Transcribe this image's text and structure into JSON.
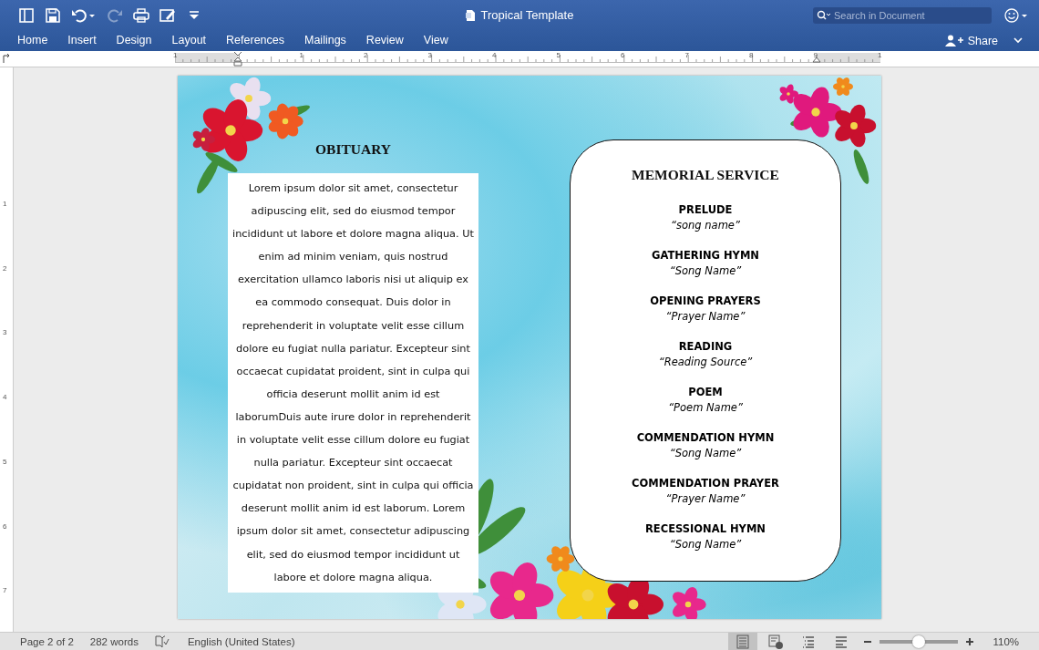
{
  "window": {
    "title": "Tropical Template"
  },
  "quick_access": [
    {
      "kind": "sidebar",
      "disabled": false
    },
    {
      "kind": "save",
      "disabled": false
    },
    {
      "kind": "undo",
      "disabled": false
    },
    {
      "kind": "redo",
      "disabled": true
    },
    {
      "kind": "print",
      "disabled": false
    },
    {
      "kind": "edit",
      "disabled": false
    },
    {
      "kind": "more",
      "disabled": false
    }
  ],
  "search": {
    "placeholder": "Search in Document"
  },
  "ribbon_tabs": [
    {
      "label": "Home",
      "selected": false
    },
    {
      "label": "Insert",
      "selected": false
    },
    {
      "label": "Design",
      "selected": false
    },
    {
      "label": "Layout",
      "selected": false
    },
    {
      "label": "References",
      "selected": false
    },
    {
      "label": "Mailings",
      "selected": false
    },
    {
      "label": "Review",
      "selected": false
    },
    {
      "label": "View",
      "selected": false
    }
  ],
  "share_button": {
    "label": "Share"
  },
  "ruler": {
    "labels": [
      "1",
      "1",
      "2",
      "3",
      "4",
      "5",
      "6",
      "7",
      "8",
      "9",
      "1"
    ]
  },
  "vertical_ruler": {
    "labels": [
      "1",
      "2",
      "3",
      "4",
      "5",
      "6",
      "7"
    ]
  },
  "document": {
    "obituary": {
      "heading": "OBITUARY",
      "body": "Lorem ipsum dolor sit amet, consectetur adipuscing elit, sed do eiusmod tempor incididunt ut labore et dolore magna aliqua. Ut enim ad minim veniam, quis nostrud exercitation ullamco laboris nisi ut aliquip ex ea commodo consequat. Duis dolor in reprehenderit in voluptate velit esse cillum dolore eu fugiat nulla pariatur. Excepteur sint occaecat cupidatat proident, sint in culpa qui officia deserunt mollit anim id est laborumDuis aute irure dolor in reprehenderit in voluptate velit esse cillum dolore eu fugiat nulla pariatur. Excepteur sint occaecat cupidatat non proident, sint in culpa qui officia deserunt mollit anim id est laborum. Lorem ipsum dolor sit amet, consectetur adipuscing elit, sed do eiusmod tempor incididunt ut labore et dolore magna aliqua."
    },
    "service": {
      "heading": "MEMORIAL SERVICE",
      "items": [
        {
          "title": "PRELUDE",
          "name": "“song name”"
        },
        {
          "title": "GATHERING HYMN",
          "name": "“Song Name”"
        },
        {
          "title": "OPENING PRAYERS",
          "name": "“Prayer Name”"
        },
        {
          "title": "READING",
          "name": "“Reading Source”"
        },
        {
          "title": "POEM",
          "name": "“Poem Name”"
        },
        {
          "title": "COMMENDATION HYMN",
          "name": "“Song Name”"
        },
        {
          "title": "COMMENDATION PRAYER",
          "name": "“Prayer Name”"
        },
        {
          "title": "RECESSIONAL HYMN",
          "name": "“Song Name”"
        }
      ]
    }
  },
  "status_bar": {
    "page": "Page 2 of 2",
    "words": "282 words",
    "language": "English (United States)",
    "views": [
      {
        "kind": "print",
        "selected": true
      },
      {
        "kind": "web",
        "selected": false
      },
      {
        "kind": "outline",
        "selected": false
      },
      {
        "kind": "draft",
        "selected": false
      }
    ],
    "zoom": {
      "level": 0.5,
      "reading": "110%"
    }
  }
}
